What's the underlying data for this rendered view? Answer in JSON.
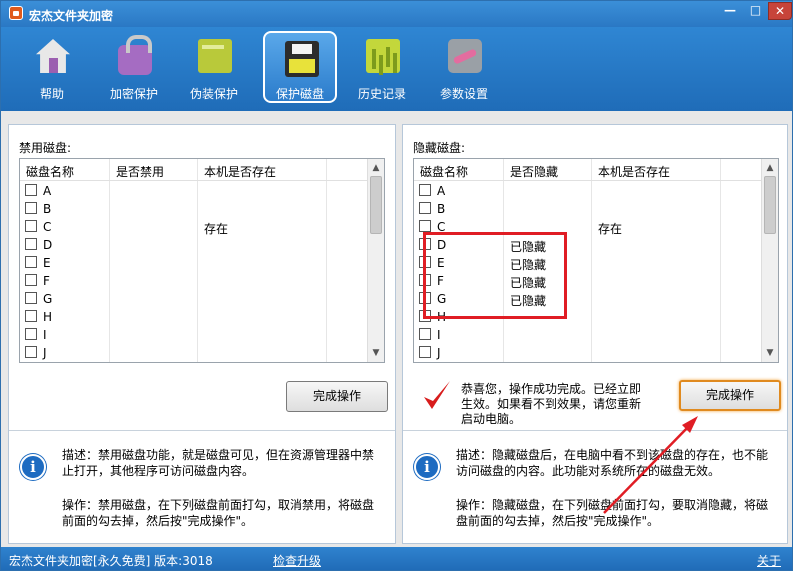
{
  "window": {
    "title": "宏杰文件夹加密",
    "minimize": "—",
    "maximize": "□",
    "close": "✕"
  },
  "toolbar": {
    "items": [
      {
        "label": "帮助",
        "icon": "home-icon"
      },
      {
        "label": "加密保护",
        "icon": "lock-icon"
      },
      {
        "label": "伪装保护",
        "icon": "book-icon"
      },
      {
        "label": "保护磁盘",
        "icon": "floppy-disk-icon",
        "active": true
      },
      {
        "label": "历史记录",
        "icon": "history-chart-icon"
      },
      {
        "label": "参数设置",
        "icon": "tools-icon"
      }
    ]
  },
  "left_panel": {
    "title": "禁用磁盘:",
    "columns": [
      "磁盘名称",
      "是否禁用",
      "本机是否存在"
    ],
    "rows": [
      {
        "name": "A",
        "status": "",
        "exists": ""
      },
      {
        "name": "B",
        "status": "",
        "exists": ""
      },
      {
        "name": "C",
        "status": "",
        "exists": "存在"
      },
      {
        "name": "D",
        "status": "",
        "exists": ""
      },
      {
        "name": "E",
        "status": "",
        "exists": ""
      },
      {
        "name": "F",
        "status": "",
        "exists": ""
      },
      {
        "name": "G",
        "status": "",
        "exists": ""
      },
      {
        "name": "H",
        "status": "",
        "exists": ""
      },
      {
        "name": "I",
        "status": "",
        "exists": ""
      },
      {
        "name": "J",
        "status": "",
        "exists": ""
      }
    ],
    "button": "完成操作",
    "desc1": "描述：禁用磁盘功能，就是磁盘可见，但在资源管理器中禁止打开，其他程序可访问磁盘内容。",
    "desc2": "操作：禁用磁盘，在下列磁盘前面打勾，取消禁用，将磁盘前面的勾去掉，然后按\"完成操作\"。"
  },
  "right_panel": {
    "title": "隐藏磁盘:",
    "columns": [
      "磁盘名称",
      "是否隐藏",
      "本机是否存在"
    ],
    "rows": [
      {
        "name": "A",
        "status": "",
        "exists": ""
      },
      {
        "name": "B",
        "status": "",
        "exists": ""
      },
      {
        "name": "C",
        "status": "",
        "exists": "存在"
      },
      {
        "name": "D",
        "status": "已隐藏",
        "exists": ""
      },
      {
        "name": "E",
        "status": "已隐藏",
        "exists": ""
      },
      {
        "name": "F",
        "status": "已隐藏",
        "exists": ""
      },
      {
        "name": "G",
        "status": "已隐藏",
        "exists": ""
      },
      {
        "name": "H",
        "status": "",
        "exists": ""
      },
      {
        "name": "I",
        "status": "",
        "exists": ""
      },
      {
        "name": "J",
        "status": "",
        "exists": ""
      }
    ],
    "success_message": "恭喜您，操作成功完成。已经立即生效。如果看不到效果，请您重新启动电脑。",
    "button": "完成操作",
    "desc1": "描述：隐藏磁盘后，在电脑中看不到该磁盘的存在，也不能访问磁盘的内容。此功能对系统所在的磁盘无效。",
    "desc2": "操作：隐藏磁盘，在下列磁盘前面打勾，要取消隐藏，将磁盘前面的勾去掉，然后按\"完成操作\"。"
  },
  "statusbar": {
    "version": "宏杰文件夹加密[永久免费]  版本:3018",
    "update_link": "检查升级",
    "about_link": "关于"
  },
  "colors": {
    "titlebar": "#2a78c4",
    "highlight_box": "#e01d24",
    "annotation_arrow": "#e01d24",
    "button_focus": "#e08a1f"
  }
}
